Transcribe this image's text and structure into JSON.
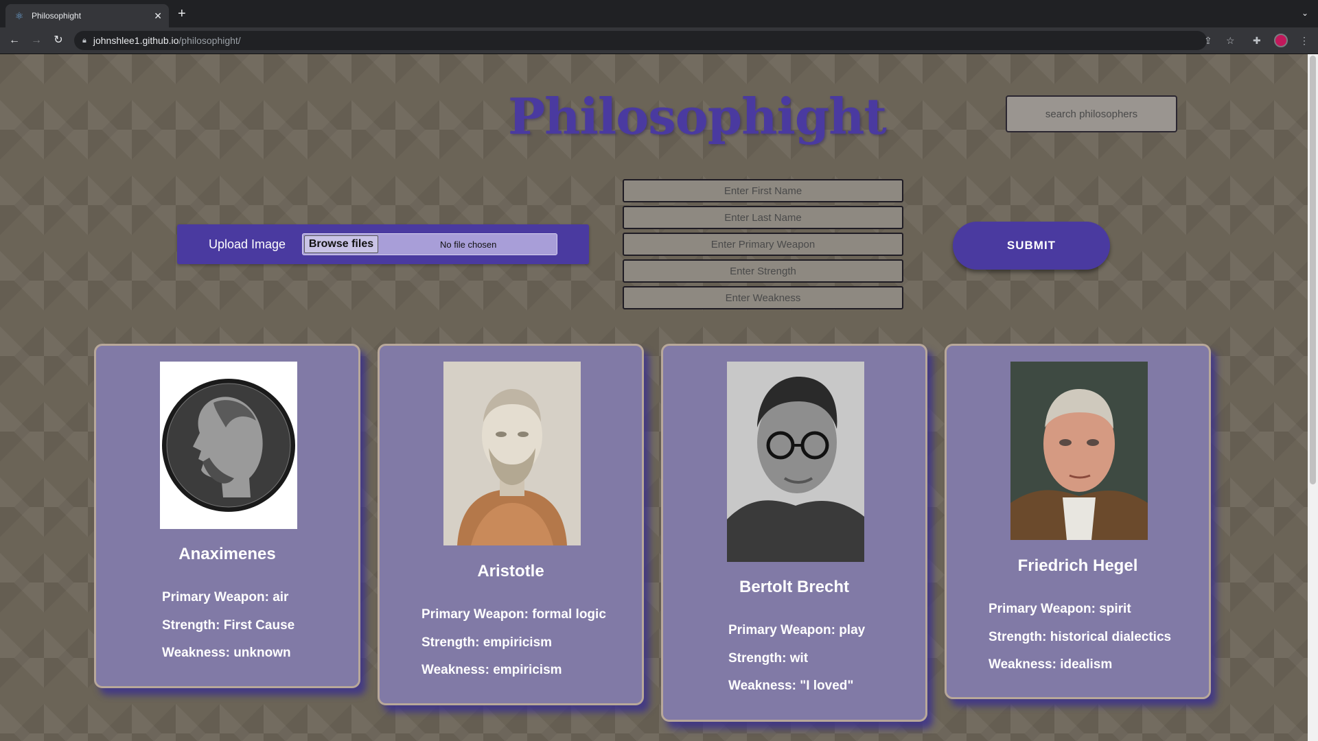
{
  "browser": {
    "tab_title": "Philosophight",
    "new_tab": "+",
    "url_host": "johnshlee1.github.io",
    "url_path": "/philosophight/"
  },
  "app": {
    "title": "Philosophight",
    "search_placeholder": "search philosophers",
    "upload_label": "Upload Image",
    "browse_label": "Browse files",
    "no_file": "No file chosen",
    "fields": {
      "first_name": "Enter First Name",
      "last_name": "Enter Last Name",
      "primary_weapon": "Enter Primary Weapon",
      "strength": "Enter Strength",
      "weakness": "Enter Weakness"
    },
    "submit_label": "SUBMIT"
  },
  "stat_labels": {
    "weapon": "Primary Weapon: ",
    "strength": "Strength: ",
    "weakness": "Weakness: "
  },
  "cards": [
    {
      "name": "Anaximenes",
      "weapon": "air",
      "strength": "First Cause",
      "weakness": "unknown"
    },
    {
      "name": "Aristotle",
      "weapon": "formal logic",
      "strength": "empiricism",
      "weakness": "empiricism"
    },
    {
      "name": "Bertolt Brecht",
      "weapon": "play",
      "strength": "wit",
      "weakness": "\"I loved\""
    },
    {
      "name": "Friedrich Hegel",
      "weapon": "spirit",
      "strength": "historical dialectics",
      "weakness": "idealism"
    }
  ]
}
